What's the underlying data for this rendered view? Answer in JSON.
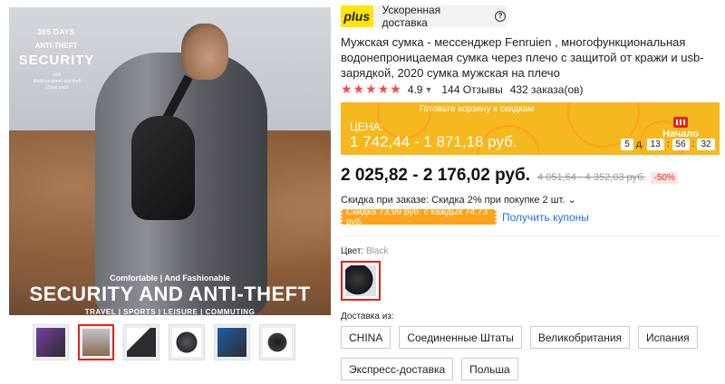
{
  "gallery": {
    "overlay": {
      "days": "365 DAYS",
      "anti_theft": "ANTI-THEFT",
      "security": "SECURITY",
      "with_text": "with\nMultifunctional anti-theft\nChest pack",
      "comfortable": "Comfortable | And Fashionable",
      "headline": "SECURITY AND ANTI-THEFT",
      "tags": "TRAVEL | SPORTS | LEISURE | COMMUTING"
    },
    "thumbnails": [
      {
        "color": "#7a3fa0",
        "active": false
      },
      {
        "color": "#8a6a50",
        "active": true
      },
      {
        "color": "#2a2c30",
        "active": false
      },
      {
        "color": "#55585d",
        "active": false
      },
      {
        "color": "#1e5fa8",
        "active": false
      },
      {
        "color": "#1b1c1e",
        "active": false
      }
    ]
  },
  "shipping_bar": {
    "badge": "plus",
    "text": "Ускоренная доставка",
    "help_icon": "?"
  },
  "product": {
    "title": "Мужская сумка - мессенджер Fenruien , многофункциональная водонепроницаемая сумка через плечо с защитой от кражи и usb-зарядкой, 2020 сумка мужская на плечо",
    "stars": "★★★★★",
    "rating": "4.9",
    "reviews": "144 Отзывы",
    "orders": "432 заказа(ов)"
  },
  "promo": {
    "banner": "Готовьте корзину к скидкам",
    "label": "ЦЕНА:",
    "price": "1 742,44 - 1 871,18 руб.",
    "start_label": "Начало",
    "timer": {
      "days": "5",
      "days_suffix": "д.",
      "hours": "13",
      "minutes": "56",
      "seconds": "32"
    }
  },
  "pricing": {
    "price": "2 025,82 - 2 176,02 руб.",
    "old_price": "4 051,64 - 4 352,03 руб.",
    "discount": "-50%",
    "order_discount": "Скидка при заказе: Скидка 2% при покупке 2 шт.",
    "order_discount_chev": "⌄",
    "coupon": "Скидка 73,99 руб. с каждых 74,73 руб.",
    "coupon_link": "Получить купоны"
  },
  "color": {
    "label": "Цвет: ",
    "value": "Black"
  },
  "shipping": {
    "label": "Доставка из:",
    "options": [
      "CHINA",
      "Соединенные Штаты",
      "Великобритания",
      "Испания",
      "Экспресс-доставка",
      "Польша"
    ]
  },
  "colors": {
    "accent_red": "#e2231a",
    "promo_orange": "#f5b81e",
    "coupon_orange": "#ffa31a",
    "plus_yellow": "#ffe500",
    "link_blue": "#1f6feb"
  }
}
